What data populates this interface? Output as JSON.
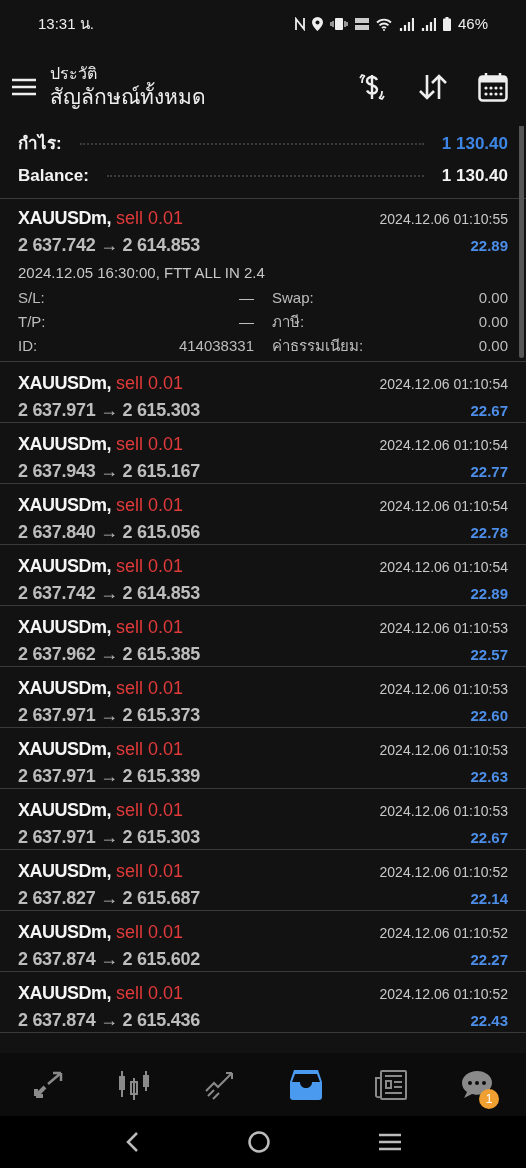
{
  "status_bar": {
    "time": "13:31 น.",
    "battery": "46%"
  },
  "header": {
    "subtitle": "ประวัติ",
    "title": "สัญลักษณ์ทั้งหมด"
  },
  "summary": [
    {
      "label": "กำไร:",
      "value": "1 130.40",
      "kind": "profit"
    },
    {
      "label": "Balance:",
      "value": "1 130.40",
      "kind": "plain"
    }
  ],
  "trades": [
    {
      "symbol": "XAUUSDm,",
      "side": "sell 0.01",
      "prices": "2 637.742 → 2 614.853",
      "time": "2024.12.06 01:10:55",
      "profit": "22.89",
      "expanded": true,
      "comment": "2024.12.05 16:30:00, FTT ALL IN 2.4",
      "details": [
        {
          "label": "S/L:",
          "value": "—"
        },
        {
          "label": "Swap:",
          "value": "0.00"
        },
        {
          "label": "T/P:",
          "value": "—"
        },
        {
          "label": "ภาษี:",
          "value": "0.00"
        },
        {
          "label": "ID:",
          "value": "414038331"
        },
        {
          "label": "ค่าธรรมเนียม:",
          "value": "0.00"
        }
      ]
    },
    {
      "symbol": "XAUUSDm,",
      "side": "sell 0.01",
      "prices": "2 637.971 → 2 615.303",
      "time": "2024.12.06 01:10:54",
      "profit": "22.67",
      "expanded": false
    },
    {
      "symbol": "XAUUSDm,",
      "side": "sell 0.01",
      "prices": "2 637.943 → 2 615.167",
      "time": "2024.12.06 01:10:54",
      "profit": "22.77",
      "expanded": false
    },
    {
      "symbol": "XAUUSDm,",
      "side": "sell 0.01",
      "prices": "2 637.840 → 2 615.056",
      "time": "2024.12.06 01:10:54",
      "profit": "22.78",
      "expanded": false
    },
    {
      "symbol": "XAUUSDm,",
      "side": "sell 0.01",
      "prices": "2 637.742 → 2 614.853",
      "time": "2024.12.06 01:10:54",
      "profit": "22.89",
      "expanded": false
    },
    {
      "symbol": "XAUUSDm,",
      "side": "sell 0.01",
      "prices": "2 637.962 → 2 615.385",
      "time": "2024.12.06 01:10:53",
      "profit": "22.57",
      "expanded": false
    },
    {
      "symbol": "XAUUSDm,",
      "side": "sell 0.01",
      "prices": "2 637.971 → 2 615.373",
      "time": "2024.12.06 01:10:53",
      "profit": "22.60",
      "expanded": false
    },
    {
      "symbol": "XAUUSDm,",
      "side": "sell 0.01",
      "prices": "2 637.971 → 2 615.339",
      "time": "2024.12.06 01:10:53",
      "profit": "22.63",
      "expanded": false
    },
    {
      "symbol": "XAUUSDm,",
      "side": "sell 0.01",
      "prices": "2 637.971 → 2 615.303",
      "time": "2024.12.06 01:10:53",
      "profit": "22.67",
      "expanded": false
    },
    {
      "symbol": "XAUUSDm,",
      "side": "sell 0.01",
      "prices": "2 637.827 → 2 615.687",
      "time": "2024.12.06 01:10:52",
      "profit": "22.14",
      "expanded": false
    },
    {
      "symbol": "XAUUSDm,",
      "side": "sell 0.01",
      "prices": "2 637.874 → 2 615.602",
      "time": "2024.12.06 01:10:52",
      "profit": "22.27",
      "expanded": false
    },
    {
      "symbol": "XAUUSDm,",
      "side": "sell 0.01",
      "prices": "2 637.874 → 2 615.436",
      "time": "2024.12.06 01:10:52",
      "profit": "22.43",
      "expanded": false
    }
  ],
  "bottom_nav": [
    {
      "kind": "quotes",
      "selected": false
    },
    {
      "kind": "chart",
      "selected": false
    },
    {
      "kind": "trade",
      "selected": false
    },
    {
      "kind": "history",
      "selected": true
    },
    {
      "kind": "news",
      "selected": false
    },
    {
      "kind": "chat",
      "selected": false,
      "badge": "1"
    }
  ]
}
